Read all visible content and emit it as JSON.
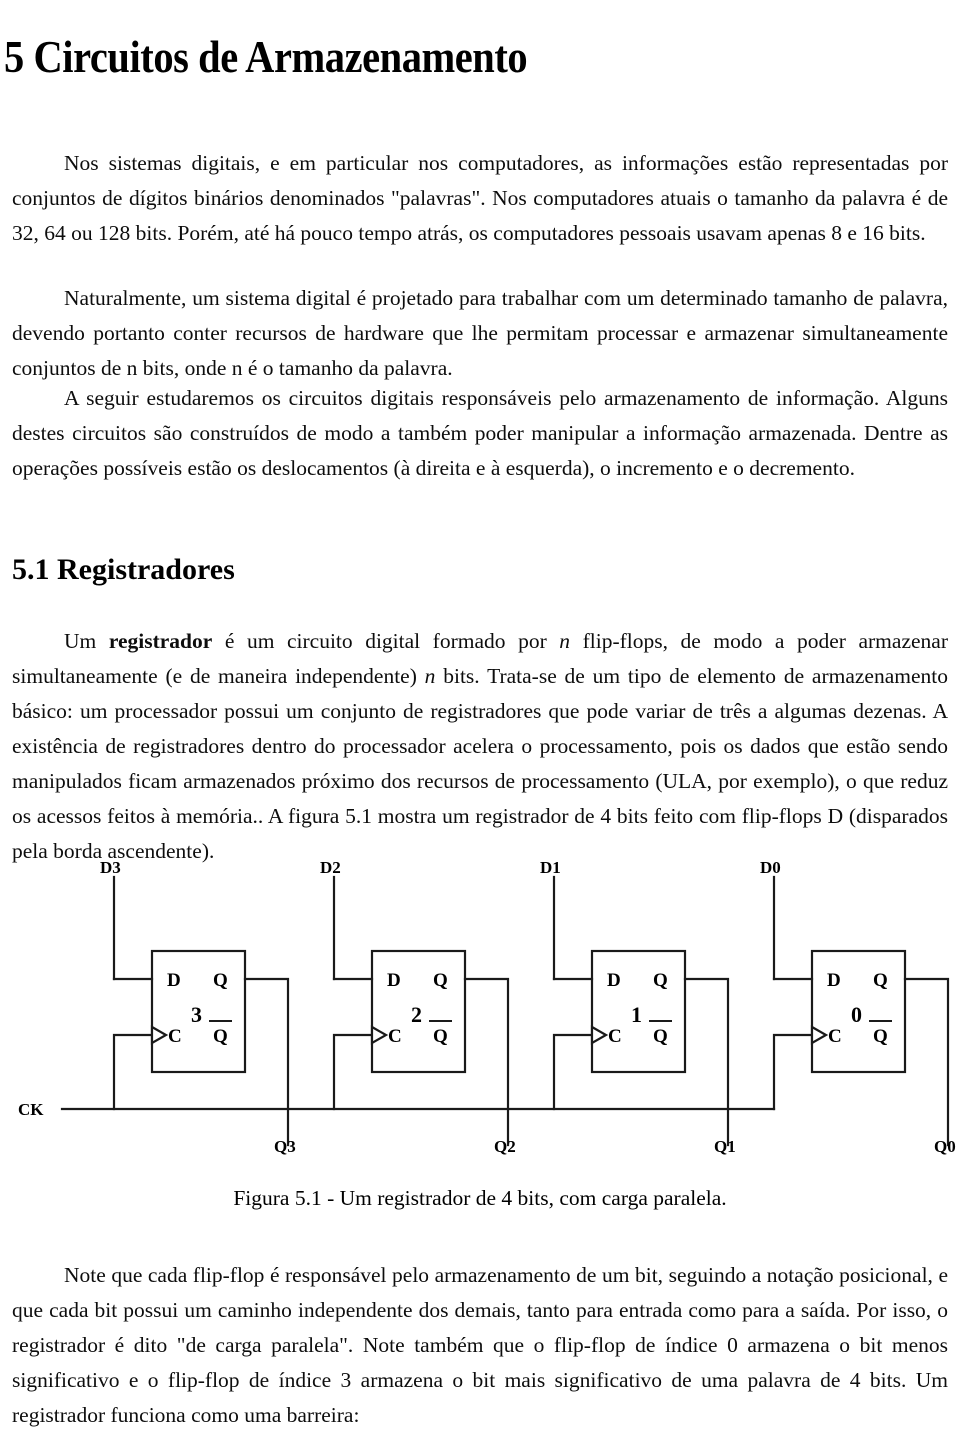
{
  "document": {
    "title": "5 Circuitos de Armazenamento",
    "section_title": "5.1 Registradores",
    "paragraphs": {
      "p1_a": "Nos sistemas digitais, e em particular nos computadores, as informações estão representadas por conjuntos de dígitos binários denominados \"palavras\". Nos computadores atuais o tamanho da palavra é de 32, 64 ou 128 bits. Porém, até há pouco tempo atrás, os computadores pessoais usavam apenas 8 e 16 bits.",
      "p2_a": "Naturalmente, um sistema digital é projetado para trabalhar com um determinado tamanho de palavra, devendo portanto conter recursos de hardware que lhe permitam processar e armazenar simultaneamente conjuntos de n bits, onde n é o tamanho da palavra.",
      "p3_a": "A seguir estudaremos os circuitos digitais responsáveis pelo armazenamento de informação. Alguns destes circuitos são construídos de modo a também poder manipular a informação armazenada. Dentre as operações possíveis estão os deslocamentos (à direita e à esquerda), o incremento e o decremento.",
      "p4_a": "Um ",
      "p4_bold1": "registrador",
      "p4_b": " é um circuito digital formado por ",
      "p4_ital1": "n",
      "p4_c": " flip-flops, de modo a poder armazenar simultaneamente (e de maneira independente) ",
      "p4_ital2": "n",
      "p4_d": " bits. Trata-se de um tipo de elemento de armazenamento básico: um processador possui um conjunto de registradores que pode variar de três a algumas dezenas. A existência de registradores dentro do processador acelera o processamento, pois os dados que estão sendo manipulados ficam armazenados próximo dos recursos de processamento (ULA, por exemplo), o que reduz os acessos feitos à memória.. A figura 5.1 mostra um registrador de 4 bits feito com flip-flops D (disparados pela borda ascendente).",
      "p5_a": "Note que cada flip-flop é responsável pelo armazenamento de um bit, seguindo a notação posicional, e que cada bit possui um caminho independente dos demais, tanto para entrada como para a saída. Por isso, o registrador é dito \"de carga paralela\". Note também que o flip-flop de índice 0 armazena o bit menos significativo e o flip-flop de índice 3 armazena o bit mais significativo de uma palavra de 4 bits. Um registrador funciona como uma barreira:"
    }
  },
  "figure": {
    "caption": "Figura 5.1 - Um registrador de 4 bits, com carga paralela.",
    "clock_label": "CK",
    "port_labels": {
      "d": "D",
      "q": "Q",
      "qbar": "Q",
      "c": "C"
    },
    "flipflops": [
      {
        "index": "3",
        "input_label": "D3",
        "output_label": "Q3"
      },
      {
        "index": "2",
        "input_label": "D2",
        "output_label": "Q2"
      },
      {
        "index": "1",
        "input_label": "D1",
        "output_label": "Q1"
      },
      {
        "index": "0",
        "input_label": "D0",
        "output_label": "Q0"
      }
    ],
    "stroke_color": "#1a1a1a"
  }
}
